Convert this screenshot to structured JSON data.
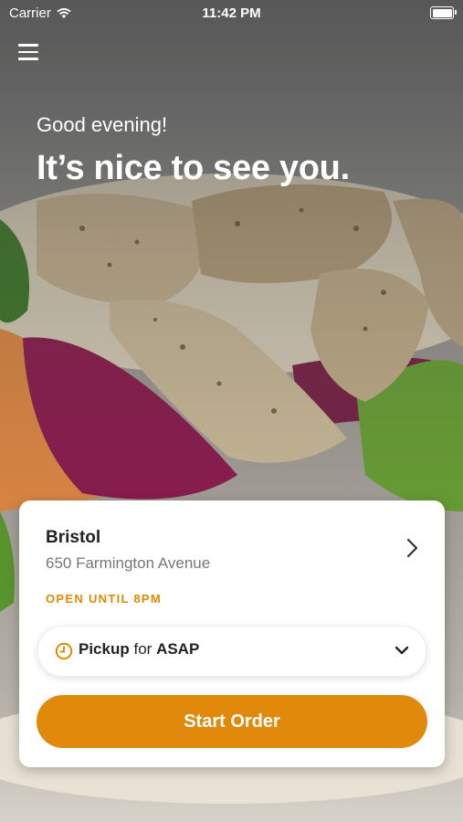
{
  "status_bar": {
    "carrier": "Carrier",
    "time": "11:42 PM",
    "icons": [
      "wifi-icon",
      "battery-icon"
    ]
  },
  "header": {
    "menu_icon": "hamburger-menu-icon",
    "greeting": "Good evening!",
    "headline": "It’s nice to see you."
  },
  "store_card": {
    "name": "Bristol",
    "address": "650 Farmington Avenue",
    "hours": "OPEN UNTIL 8PM",
    "hours_color": "#E08A00",
    "chevron_icon": "chevron-right-icon",
    "order_mode": {
      "icon": "clock-icon",
      "mode": "Pickup",
      "connector": "for",
      "time": "ASAP",
      "dropdown_icon": "chevron-down-icon"
    },
    "start_button": "Start Order",
    "accent_color": "#E0890A"
  }
}
